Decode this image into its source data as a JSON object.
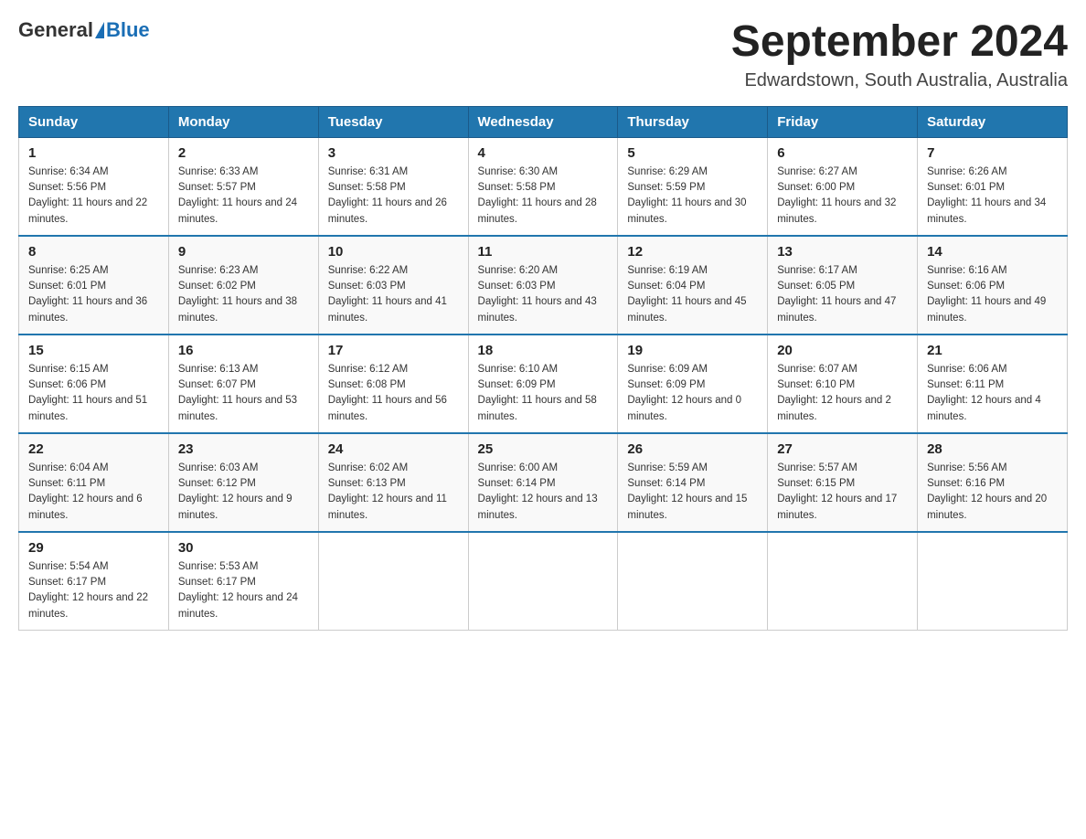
{
  "header": {
    "logo_general": "General",
    "logo_blue": "Blue",
    "month_year": "September 2024",
    "location": "Edwardstown, South Australia, Australia"
  },
  "days_of_week": [
    "Sunday",
    "Monday",
    "Tuesday",
    "Wednesday",
    "Thursday",
    "Friday",
    "Saturday"
  ],
  "weeks": [
    [
      {
        "day": "1",
        "sunrise": "6:34 AM",
        "sunset": "5:56 PM",
        "daylight": "11 hours and 22 minutes."
      },
      {
        "day": "2",
        "sunrise": "6:33 AM",
        "sunset": "5:57 PM",
        "daylight": "11 hours and 24 minutes."
      },
      {
        "day": "3",
        "sunrise": "6:31 AM",
        "sunset": "5:58 PM",
        "daylight": "11 hours and 26 minutes."
      },
      {
        "day": "4",
        "sunrise": "6:30 AM",
        "sunset": "5:58 PM",
        "daylight": "11 hours and 28 minutes."
      },
      {
        "day": "5",
        "sunrise": "6:29 AM",
        "sunset": "5:59 PM",
        "daylight": "11 hours and 30 minutes."
      },
      {
        "day": "6",
        "sunrise": "6:27 AM",
        "sunset": "6:00 PM",
        "daylight": "11 hours and 32 minutes."
      },
      {
        "day": "7",
        "sunrise": "6:26 AM",
        "sunset": "6:01 PM",
        "daylight": "11 hours and 34 minutes."
      }
    ],
    [
      {
        "day": "8",
        "sunrise": "6:25 AM",
        "sunset": "6:01 PM",
        "daylight": "11 hours and 36 minutes."
      },
      {
        "day": "9",
        "sunrise": "6:23 AM",
        "sunset": "6:02 PM",
        "daylight": "11 hours and 38 minutes."
      },
      {
        "day": "10",
        "sunrise": "6:22 AM",
        "sunset": "6:03 PM",
        "daylight": "11 hours and 41 minutes."
      },
      {
        "day": "11",
        "sunrise": "6:20 AM",
        "sunset": "6:03 PM",
        "daylight": "11 hours and 43 minutes."
      },
      {
        "day": "12",
        "sunrise": "6:19 AM",
        "sunset": "6:04 PM",
        "daylight": "11 hours and 45 minutes."
      },
      {
        "day": "13",
        "sunrise": "6:17 AM",
        "sunset": "6:05 PM",
        "daylight": "11 hours and 47 minutes."
      },
      {
        "day": "14",
        "sunrise": "6:16 AM",
        "sunset": "6:06 PM",
        "daylight": "11 hours and 49 minutes."
      }
    ],
    [
      {
        "day": "15",
        "sunrise": "6:15 AM",
        "sunset": "6:06 PM",
        "daylight": "11 hours and 51 minutes."
      },
      {
        "day": "16",
        "sunrise": "6:13 AM",
        "sunset": "6:07 PM",
        "daylight": "11 hours and 53 minutes."
      },
      {
        "day": "17",
        "sunrise": "6:12 AM",
        "sunset": "6:08 PM",
        "daylight": "11 hours and 56 minutes."
      },
      {
        "day": "18",
        "sunrise": "6:10 AM",
        "sunset": "6:09 PM",
        "daylight": "11 hours and 58 minutes."
      },
      {
        "day": "19",
        "sunrise": "6:09 AM",
        "sunset": "6:09 PM",
        "daylight": "12 hours and 0 minutes."
      },
      {
        "day": "20",
        "sunrise": "6:07 AM",
        "sunset": "6:10 PM",
        "daylight": "12 hours and 2 minutes."
      },
      {
        "day": "21",
        "sunrise": "6:06 AM",
        "sunset": "6:11 PM",
        "daylight": "12 hours and 4 minutes."
      }
    ],
    [
      {
        "day": "22",
        "sunrise": "6:04 AM",
        "sunset": "6:11 PM",
        "daylight": "12 hours and 6 minutes."
      },
      {
        "day": "23",
        "sunrise": "6:03 AM",
        "sunset": "6:12 PM",
        "daylight": "12 hours and 9 minutes."
      },
      {
        "day": "24",
        "sunrise": "6:02 AM",
        "sunset": "6:13 PM",
        "daylight": "12 hours and 11 minutes."
      },
      {
        "day": "25",
        "sunrise": "6:00 AM",
        "sunset": "6:14 PM",
        "daylight": "12 hours and 13 minutes."
      },
      {
        "day": "26",
        "sunrise": "5:59 AM",
        "sunset": "6:14 PM",
        "daylight": "12 hours and 15 minutes."
      },
      {
        "day": "27",
        "sunrise": "5:57 AM",
        "sunset": "6:15 PM",
        "daylight": "12 hours and 17 minutes."
      },
      {
        "day": "28",
        "sunrise": "5:56 AM",
        "sunset": "6:16 PM",
        "daylight": "12 hours and 20 minutes."
      }
    ],
    [
      {
        "day": "29",
        "sunrise": "5:54 AM",
        "sunset": "6:17 PM",
        "daylight": "12 hours and 22 minutes."
      },
      {
        "day": "30",
        "sunrise": "5:53 AM",
        "sunset": "6:17 PM",
        "daylight": "12 hours and 24 minutes."
      },
      null,
      null,
      null,
      null,
      null
    ]
  ]
}
